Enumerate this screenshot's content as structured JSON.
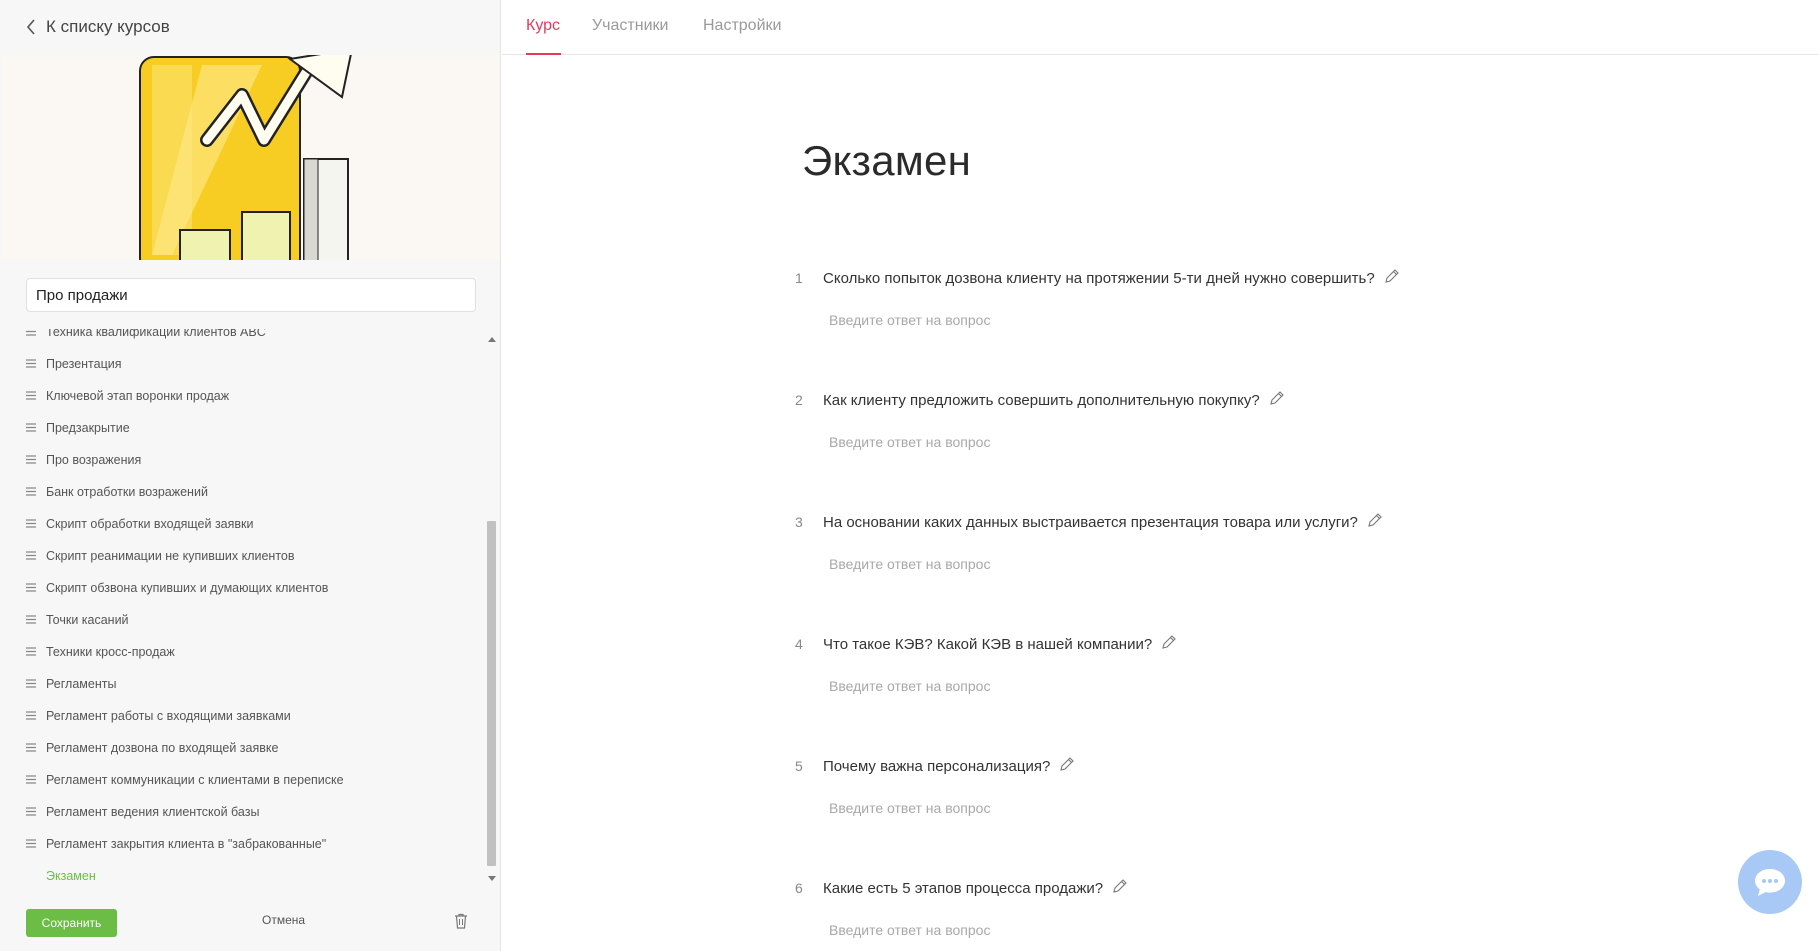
{
  "sidebar": {
    "back_label": "К списку курсов",
    "course_name": "Про продажи",
    "lessons": [
      "Техника квалификации клиентов ABC",
      "Презентация",
      "Ключевой этап воронки продаж",
      "Предзакрытие",
      "Про возражения",
      "Банк отработки возражений",
      "Скрипт обработки входящей заявки",
      "Скрипт реанимации не купивших клиентов",
      "Скрипт обзвона купивших и думающих клиентов",
      "Точки касаний",
      "Техники кросс-продаж",
      "Регламенты",
      "Регламент работы с входящими заявками",
      "Регламент дозвона по входящей заявке",
      "Регламент коммуникации с клиентами в переписке",
      "Регламент ведения клиентской базы",
      "Регламент закрытия клиента в \"забракованные\""
    ],
    "active_lesson": "Экзамен",
    "save_label": "Сохранить",
    "cancel_label": "Отмена"
  },
  "tabs": [
    "Курс",
    "Участники",
    "Настройки"
  ],
  "page_title": "Экзамен",
  "answer_placeholder": "Введите ответ на вопрос",
  "questions": [
    {
      "num": "1",
      "text": "Сколько попыток дозвона клиенту на протяжении 5-ти дней нужно совершить?"
    },
    {
      "num": "2",
      "text": "Как клиенту предложить совершить дополнительную покупку?"
    },
    {
      "num": "3",
      "text": "На основании каких данных выстраивается презентация товара или услуги?"
    },
    {
      "num": "4",
      "text": "Что такое КЭВ? Какой КЭВ в нашей компании?"
    },
    {
      "num": "5",
      "text": "Почему важна персонализация?"
    },
    {
      "num": "6",
      "text": "Какие есть 5 этапов процесса продажи?"
    }
  ],
  "colors": {
    "accent": "#e63a5d",
    "success": "#6cbd45",
    "chat": "#a8c8f5"
  }
}
